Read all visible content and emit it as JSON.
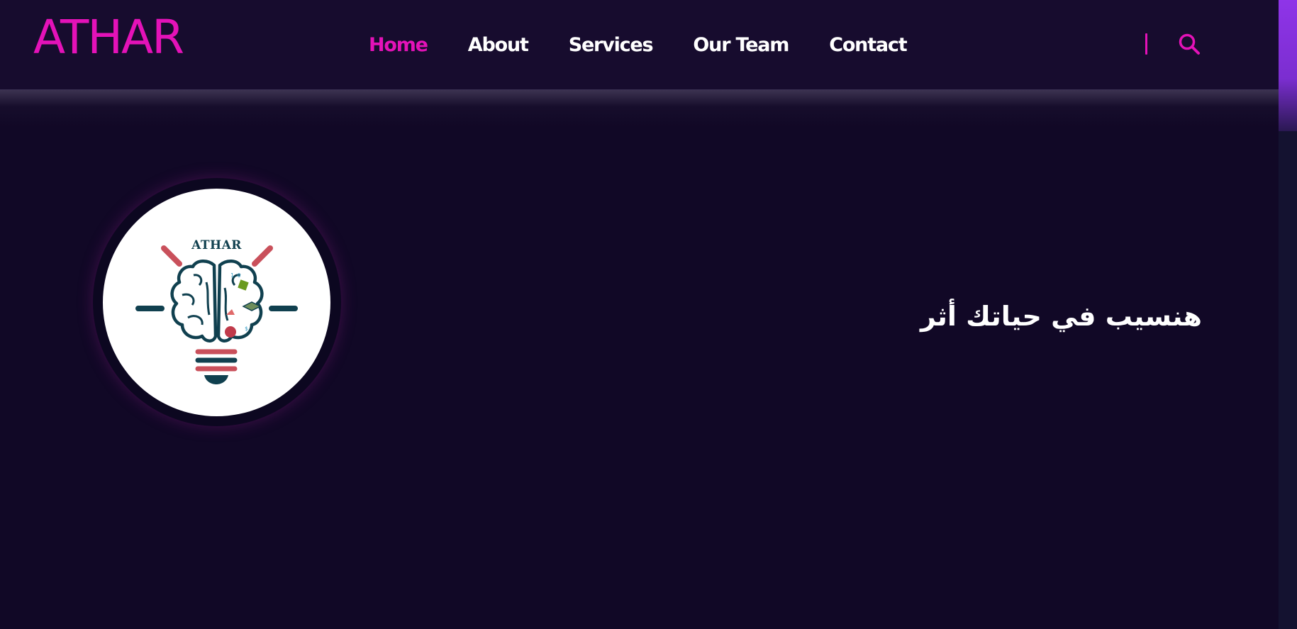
{
  "header": {
    "brand": "ATHAR",
    "nav": [
      {
        "label": "Home",
        "active": true
      },
      {
        "label": "About",
        "active": false
      },
      {
        "label": "Services",
        "active": false
      },
      {
        "label": "Our Team",
        "active": false
      },
      {
        "label": "Contact",
        "active": false
      }
    ],
    "search_icon": "search-icon"
  },
  "hero": {
    "logo_text": "ATHAR",
    "logo_icon": "brain-lightbulb-logo",
    "tagline": "هنسيب في حياتك أثر"
  },
  "colors": {
    "background": "#110826",
    "header_bg": "#170c2e",
    "accent": "#e412b8",
    "nav_text": "#ffffff",
    "scrollbar": "#8f34e8"
  }
}
